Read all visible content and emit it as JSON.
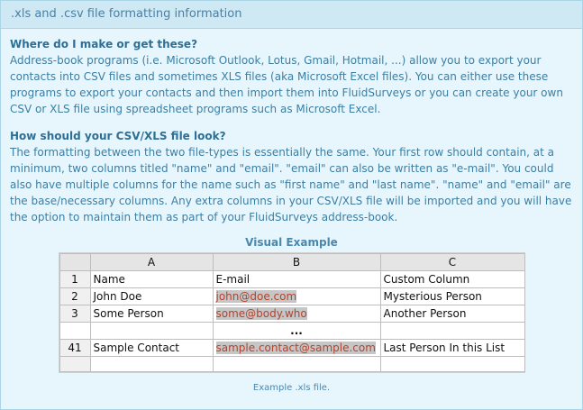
{
  "header": {
    "title": ".xls and .csv file formatting information"
  },
  "sections": [
    {
      "question": "Where do I make or get these?",
      "paragraph": "Address-book programs (i.e. Microsoft Outlook, Lotus, Gmail, Hotmail, ...) allow you to export your contacts into CSV files and sometimes XLS files (aka Microsoft Excel files). You can either use these programs to export your contacts and then import them into FluidSurveys or you can create your own CSV or XLS file using spreadsheet programs such as Microsoft Excel."
    },
    {
      "question": "How should your CSV/XLS file look?",
      "paragraph": "The formatting between the two file-types is essentially the same. Your first row should contain, at a minimum, two columns titled \"name\" and \"email\". \"email\" can also be written as \"e-mail\". You could also have multiple columns for the name such as \"first name\" and \"last name\". \"name\" and \"email\" are the base/necessary columns. Any extra columns in your CSV/XLS file will be imported and you will have the option to maintain them as part of your FluidSurveys address-book."
    }
  ],
  "visual": {
    "title": "Visual Example",
    "caption": "Example .xls file.",
    "columns": [
      "",
      "A",
      "B",
      "C"
    ],
    "rows": [
      {
        "num": "1",
        "a": "Name",
        "b": "E-mail",
        "c": "Custom Column"
      },
      {
        "num": "2",
        "a": "John Doe",
        "b": "john@doe.com",
        "c": "Mysterious Person"
      },
      {
        "num": "3",
        "a": "Some Person",
        "b": "some@body.who",
        "c": "Another Person"
      },
      {
        "num": "41",
        "a": "Sample Contact",
        "b": "sample.contact@sample.com",
        "c": "Last Person In this List"
      }
    ],
    "ellipsis": "..."
  }
}
